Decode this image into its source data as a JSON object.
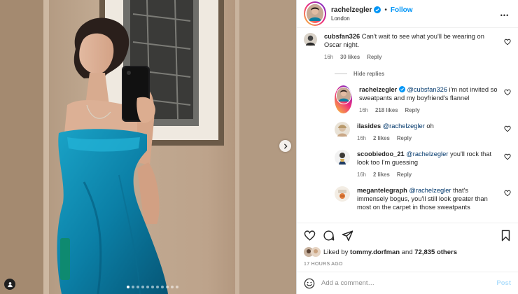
{
  "media": {
    "carousel_count": 11,
    "active_index": 0
  },
  "header": {
    "username": "rachelzegler",
    "separator": "•",
    "follow_label": "Follow",
    "location": "London",
    "more_label": "•••"
  },
  "comments": [
    {
      "username": "cubsfan326",
      "text": "Can't wait to see what you'll be wearing on Oscar night.",
      "time": "16h",
      "likes": "30 likes",
      "reply_label": "Reply"
    }
  ],
  "hide_replies_label": "Hide replies",
  "replies": [
    {
      "username": "rachelzegler",
      "mention": "@cubsfan326",
      "text": " i'm not invited so sweatpants and my boyfriend's flannel",
      "time": "16h",
      "likes": "218 likes",
      "reply_label": "Reply"
    },
    {
      "username": "ilasides",
      "mention": "@rachelzegler",
      "text": " oh",
      "time": "16h",
      "likes": "2 likes",
      "reply_label": "Reply"
    },
    {
      "username": "scoobiedoo_21",
      "mention": "@rachelzegler",
      "text": " you'll rock that look too I'm guessing",
      "time": "16h",
      "likes": "2 likes",
      "reply_label": "Reply"
    },
    {
      "username": "megantelegraph",
      "mention": "@rachelzegler",
      "text": " that's immensely bogus, you'll still look greater than most on the carpet in those sweatpants",
      "time": "",
      "likes": "",
      "reply_label": ""
    }
  ],
  "actions": {
    "liked_by_prefix": "Liked by ",
    "liked_by_user": "tommy.dorfman",
    "liked_by_and": " and ",
    "others": "72,835 others",
    "timestamp": "17 HOURS AGO"
  },
  "add_comment": {
    "placeholder": "Add a comment…",
    "post_label": "Post"
  },
  "colors": {
    "link_blue": "#0095f6",
    "mention_blue": "#00376b",
    "dress_teal": "#0d7fa3"
  },
  "icons": [
    "chevron-right-icon",
    "user-tag-icon",
    "verified-badge-icon",
    "more-horizontal-icon",
    "heart-outline-icon",
    "comment-bubble-icon",
    "share-paper-plane-icon",
    "bookmark-icon",
    "emoji-smile-icon"
  ]
}
